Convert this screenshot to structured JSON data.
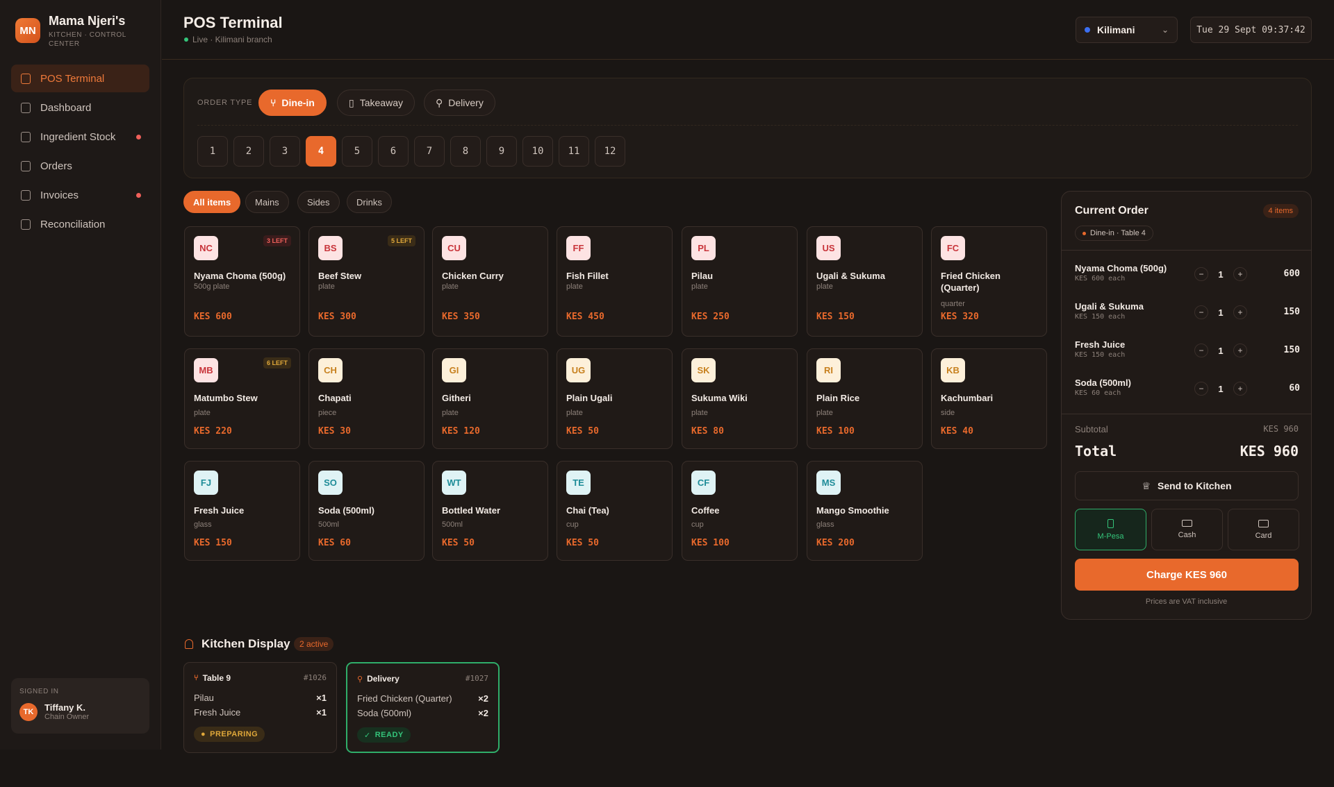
{
  "brand": {
    "initials": "MN",
    "name": "Mama Njeri's",
    "subtitle": "KITCHEN · CONTROL CENTER"
  },
  "nav": [
    {
      "label": "POS Terminal",
      "active": true,
      "alert": false
    },
    {
      "label": "Dashboard",
      "active": false,
      "alert": false
    },
    {
      "label": "Ingredient Stock",
      "active": false,
      "alert": true
    },
    {
      "label": "Orders",
      "active": false,
      "alert": false
    },
    {
      "label": "Invoices",
      "active": false,
      "alert": true
    },
    {
      "label": "Reconciliation",
      "active": false,
      "alert": false
    }
  ],
  "signed_in": {
    "label": "SIGNED IN",
    "initials": "TK",
    "name": "Tiffany K.",
    "role": "Chain Owner"
  },
  "header": {
    "title": "POS Terminal",
    "status": "Live · Kilimani branch",
    "branch": "Kilimani",
    "clock": "Tue 29 Sept 09:37:42"
  },
  "order_type": {
    "label": "ORDER TYPE",
    "options": [
      {
        "label": "Dine-in",
        "icon": "utensils-icon",
        "active": true
      },
      {
        "label": "Takeaway",
        "icon": "bag-icon",
        "active": false
      },
      {
        "label": "Delivery",
        "icon": "bike-icon",
        "active": false
      }
    ],
    "tables": [
      "1",
      "2",
      "3",
      "4",
      "5",
      "6",
      "7",
      "8",
      "9",
      "10",
      "11",
      "12"
    ],
    "selected_table": "4"
  },
  "categories": [
    {
      "label": "All items",
      "active": true
    },
    {
      "label": "Mains",
      "active": false
    },
    {
      "label": "Sides",
      "active": false
    },
    {
      "label": "Drinks",
      "active": false
    }
  ],
  "menu_items": [
    {
      "code": "NC",
      "name": "Nyama Choma (500g)",
      "unit": "500g plate",
      "price": "KES 600",
      "stock": "3 LEFT",
      "tone": "red"
    },
    {
      "code": "BS",
      "name": "Beef Stew",
      "unit": "plate",
      "price": "KES 300",
      "stock": "5 LEFT",
      "tone": "red"
    },
    {
      "code": "CU",
      "name": "Chicken Curry",
      "unit": "plate",
      "price": "KES 350",
      "stock": "",
      "tone": "red"
    },
    {
      "code": "FF",
      "name": "Fish Fillet",
      "unit": "plate",
      "price": "KES 450",
      "stock": "",
      "tone": "red"
    },
    {
      "code": "PL",
      "name": "Pilau",
      "unit": "plate",
      "price": "KES 250",
      "stock": "",
      "tone": "red"
    },
    {
      "code": "US",
      "name": "Ugali & Sukuma",
      "unit": "plate",
      "price": "KES 150",
      "stock": "",
      "tone": "red"
    },
    {
      "code": "FC",
      "name": "Fried Chicken (Quarter)",
      "unit": "quarter",
      "price": "KES 320",
      "stock": "",
      "tone": "red"
    },
    {
      "code": "MB",
      "name": "Matumbo Stew",
      "unit": "plate",
      "price": "KES 220",
      "stock": "6 LEFT",
      "tone": "red"
    },
    {
      "code": "CH",
      "name": "Chapati",
      "unit": "piece",
      "price": "KES 30",
      "stock": "",
      "tone": "amber"
    },
    {
      "code": "GI",
      "name": "Githeri",
      "unit": "plate",
      "price": "KES 120",
      "stock": "",
      "tone": "amber"
    },
    {
      "code": "UG",
      "name": "Plain Ugali",
      "unit": "plate",
      "price": "KES 50",
      "stock": "",
      "tone": "amber"
    },
    {
      "code": "SK",
      "name": "Sukuma Wiki",
      "unit": "plate",
      "price": "KES 80",
      "stock": "",
      "tone": "amber"
    },
    {
      "code": "RI",
      "name": "Plain Rice",
      "unit": "plate",
      "price": "KES 100",
      "stock": "",
      "tone": "amber"
    },
    {
      "code": "KB",
      "name": "Kachumbari",
      "unit": "side",
      "price": "KES 40",
      "stock": "",
      "tone": "amber"
    },
    {
      "code": "FJ",
      "name": "Fresh Juice",
      "unit": "glass",
      "price": "KES 150",
      "stock": "",
      "tone": "teal"
    },
    {
      "code": "SO",
      "name": "Soda (500ml)",
      "unit": "500ml",
      "price": "KES 60",
      "stock": "",
      "tone": "teal"
    },
    {
      "code": "WT",
      "name": "Bottled Water",
      "unit": "500ml",
      "price": "KES 50",
      "stock": "",
      "tone": "teal"
    },
    {
      "code": "TE",
      "name": "Chai (Tea)",
      "unit": "cup",
      "price": "KES 50",
      "stock": "",
      "tone": "teal"
    },
    {
      "code": "CF",
      "name": "Coffee",
      "unit": "cup",
      "price": "KES 100",
      "stock": "",
      "tone": "teal"
    },
    {
      "code": "MS",
      "name": "Mango Smoothie",
      "unit": "glass",
      "price": "KES 200",
      "stock": "",
      "tone": "teal"
    }
  ],
  "cart": {
    "title": "Current Order",
    "count": "4 items",
    "context": "Dine-in · Table 4",
    "lines": [
      {
        "name": "Nyama Choma (500g)",
        "each": "KES 600 each",
        "qty": "1",
        "total": "600"
      },
      {
        "name": "Ugali & Sukuma",
        "each": "KES 150 each",
        "qty": "1",
        "total": "150"
      },
      {
        "name": "Fresh Juice",
        "each": "KES 150 each",
        "qty": "1",
        "total": "150"
      },
      {
        "name": "Soda (500ml)",
        "each": "KES 60 each",
        "qty": "1",
        "total": "60"
      }
    ],
    "subtotal_label": "Subtotal",
    "subtotal": "KES 960",
    "total_label": "Total",
    "total": "KES 960",
    "send_label": "Send to Kitchen",
    "payment_methods": [
      {
        "label": "M-Pesa",
        "active": true
      },
      {
        "label": "Cash",
        "active": false
      },
      {
        "label": "Card",
        "active": false
      }
    ],
    "charge_label": "Charge KES 960",
    "vat_note": "Prices are VAT inclusive"
  },
  "kitchen": {
    "title": "Kitchen Display",
    "active_count": "2 active",
    "tickets": [
      {
        "label": "Table 9",
        "number": "#1026",
        "items": [
          {
            "name": "Pilau",
            "qty": "×1"
          },
          {
            "name": "Fresh Juice",
            "qty": "×1"
          }
        ],
        "status": "PREPARING"
      },
      {
        "label": "Delivery",
        "number": "#1027",
        "items": [
          {
            "name": "Fried Chicken (Quarter)",
            "qty": "×2"
          },
          {
            "name": "Soda (500ml)",
            "qty": "×2"
          }
        ],
        "status": "READY"
      }
    ]
  },
  "colors": {
    "accent": "#e8692c",
    "success": "#34c47a",
    "warning": "#e0a83a",
    "background": "#1a1614"
  }
}
